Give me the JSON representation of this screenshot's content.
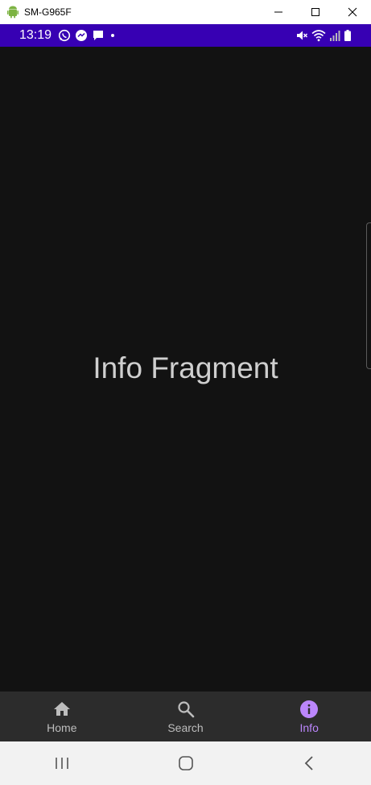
{
  "window": {
    "title": "SM-G965F",
    "icon": "android-icon",
    "controls": [
      "minimize-icon",
      "maximize-icon",
      "close-icon"
    ]
  },
  "status_bar": {
    "time": "13:19",
    "color": "#3700b3",
    "left_icons": [
      "whatsapp-icon",
      "messenger-icon",
      "chat-icon",
      "dot-icon"
    ],
    "right_icons": [
      "mute-icon",
      "wifi-icon",
      "signal-icon",
      "battery-icon"
    ]
  },
  "content": {
    "text": "Info Fragment",
    "background": "#121212"
  },
  "bottom_nav": {
    "items": [
      {
        "label": "Home",
        "icon": "home-icon",
        "active": false
      },
      {
        "label": "Search",
        "icon": "search-icon",
        "active": false
      },
      {
        "label": "Info",
        "icon": "info-icon",
        "active": true
      }
    ],
    "active_color": "#bb86fc",
    "inactive_color": "#bdbdbd"
  },
  "system_nav": {
    "buttons": [
      "recents-icon",
      "home-circle-icon",
      "back-icon"
    ]
  }
}
